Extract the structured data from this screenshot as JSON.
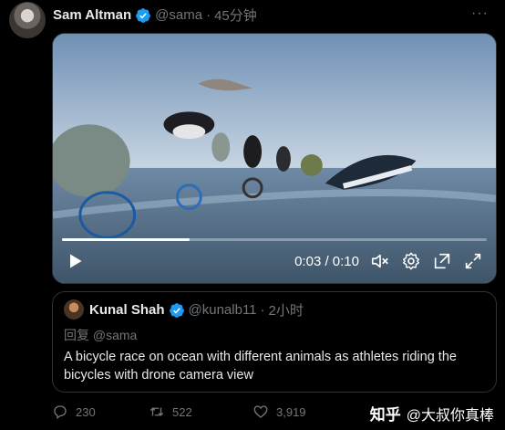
{
  "post": {
    "author_name": "Sam Altman",
    "handle": "@sama",
    "separator": "·",
    "time": "45分钟",
    "more_icon": "more-icon"
  },
  "video": {
    "current_time": "0:03",
    "duration": "0:10",
    "time_display": "0:03 / 0:10",
    "progress": 0.3,
    "icons": [
      "play-icon",
      "mute-icon",
      "settings-icon",
      "popout-icon",
      "fullscreen-icon"
    ]
  },
  "quote": {
    "author_name": "Kunal Shah",
    "handle": "@kunalb11",
    "separator": "·",
    "time": "2小时",
    "reply_to": "回复 @sama",
    "text": "A bicycle race on ocean with different animals as athletes riding the bicycles with drone camera view"
  },
  "actions": {
    "replies": "230",
    "retweets": "522",
    "likes": "3,919"
  },
  "watermark": {
    "logo": "知乎",
    "text": "@大叔你真棒"
  },
  "colors": {
    "background": "#000000",
    "text": "#e7e9ea",
    "muted": "#71767b",
    "verified": "#1d9bf0",
    "border": "#2f3336"
  }
}
